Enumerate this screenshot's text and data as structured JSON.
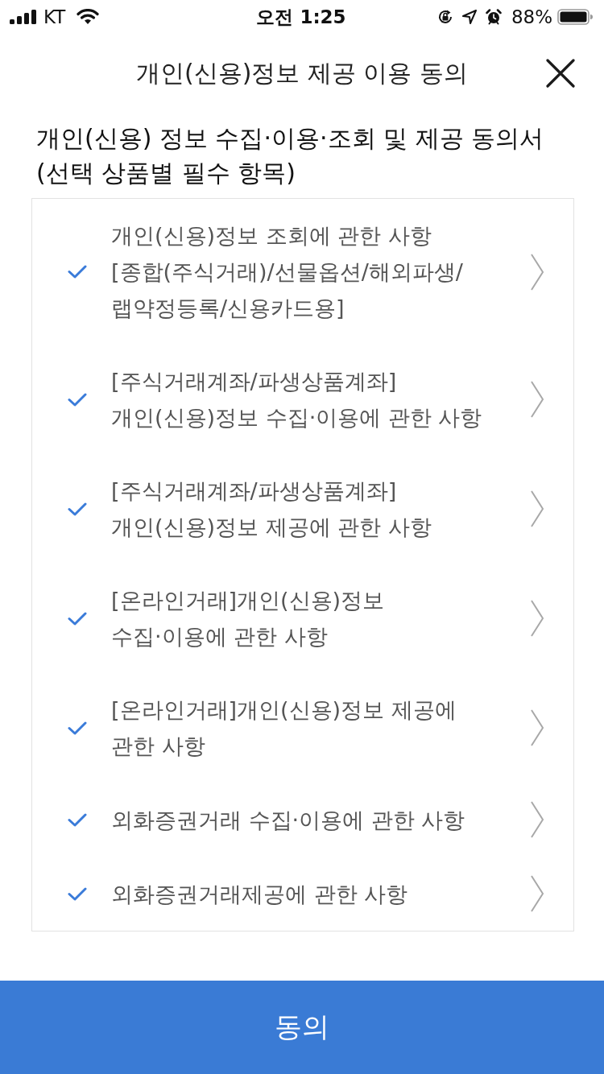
{
  "status_bar": {
    "carrier": "KT",
    "time": "오전 1:25",
    "battery": "88%"
  },
  "header": {
    "title": "개인(신용)정보 제공 이용 동의"
  },
  "heading": {
    "lines": [
      "개인(신용) 정보 수집·이용·조회 및 제공 동의서",
      "(선택 상품별 필수 항목)"
    ]
  },
  "items": [
    {
      "lines": [
        "개인(신용)정보 조회에 관한 사항",
        "[종합(주식거래)/선물옵션/해외파생/",
        "랩약정등록/신용카드용]"
      ],
      "checked": true
    },
    {
      "lines": [
        "[주식거래계좌/파생상품계좌]",
        "개인(신용)정보 수집·이용에 관한 사항"
      ],
      "checked": true
    },
    {
      "lines": [
        "[주식거래계좌/파생상품계좌]",
        "개인(신용)정보 제공에 관한 사항"
      ],
      "checked": true
    },
    {
      "lines": [
        "[온라인거래]개인(신용)정보",
        "수집·이용에 관한 사항"
      ],
      "checked": true
    },
    {
      "lines": [
        "[온라인거래]개인(신용)정보 제공에",
        "관한 사항"
      ],
      "checked": true
    },
    {
      "lines": [
        "외화증권거래 수집·이용에 관한 사항"
      ],
      "checked": true
    },
    {
      "lines": [
        "외화증권거래제공에 관한 사항"
      ],
      "checked": true
    }
  ],
  "agree_button": {
    "label": "동의"
  }
}
